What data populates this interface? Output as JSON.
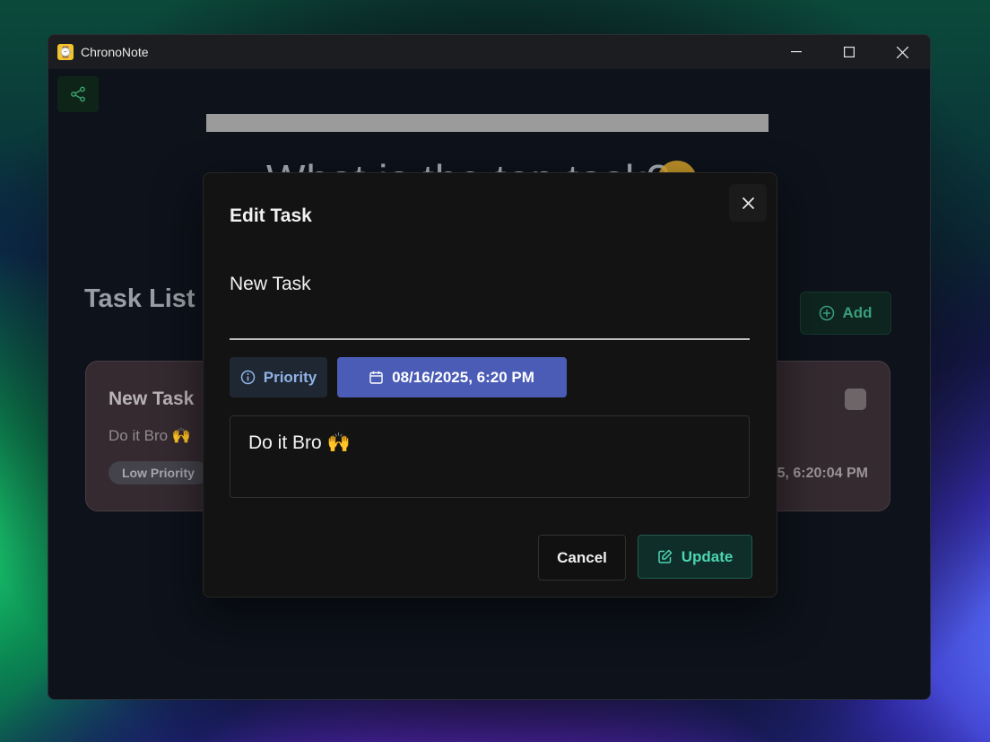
{
  "window": {
    "title": "ChronoNote",
    "minimize_icon": "minimize-icon",
    "maximize_icon": "maximize-icon",
    "close_icon": "close-icon"
  },
  "toolbar": {
    "share_icon": "share-icon"
  },
  "hero": {
    "text": "What is the top task?",
    "emoji": "smile-emoji"
  },
  "task_list": {
    "title": "Task List",
    "add_label": "Add",
    "cards": [
      {
        "title": "New Task",
        "description": "Do it Bro 🙌",
        "priority": "Low Priority",
        "timestamp": "5, 6:20:04 PM"
      }
    ]
  },
  "modal": {
    "title": "Edit Task",
    "task_name": "New Task",
    "priority_label": "Priority",
    "date_label": "08/16/2025, 6:20 PM",
    "description": "Do it Bro 🙌",
    "cancel_label": "Cancel",
    "update_label": "Update"
  },
  "colors": {
    "accent_blue": "#4a5cb6",
    "accent_green": "#4cd6b0",
    "card_bg": "#342a30"
  }
}
